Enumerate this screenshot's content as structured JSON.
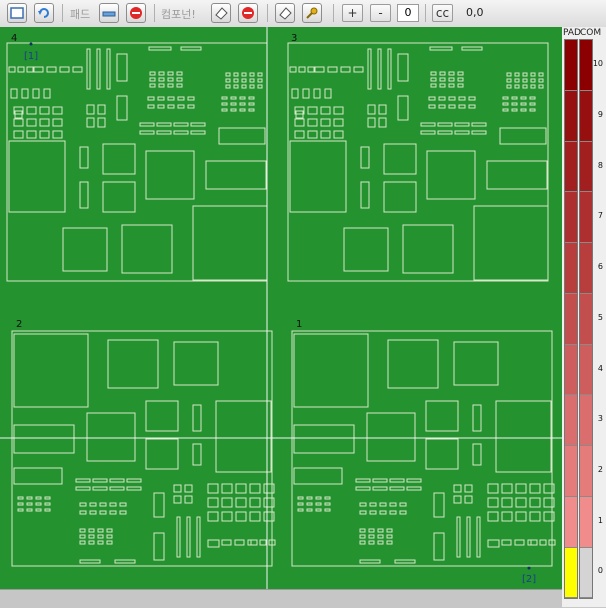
{
  "toolbar": {
    "pad_label": "패드",
    "component_label": "컴포넌!",
    "plus_label": "+",
    "minus_label": "-",
    "zoom_value": "0",
    "cc_label": "cc",
    "coordinate": "0,0"
  },
  "board": {
    "quadrants": [
      {
        "label": "4"
      },
      {
        "label": "3"
      },
      {
        "label": "2"
      },
      {
        "label": "1"
      }
    ],
    "markers": [
      "[1]",
      "[2]"
    ],
    "background_color": "#23922f",
    "outline_color": "#d6e8c8"
  },
  "legend": {
    "headers": [
      "PAD",
      "COM"
    ],
    "ticks": [
      "10",
      "9",
      "8",
      "7",
      "6",
      "5",
      "4",
      "3",
      "2",
      "1",
      "0"
    ],
    "low_color": "#ffff00",
    "high_color": "#8b0000"
  }
}
